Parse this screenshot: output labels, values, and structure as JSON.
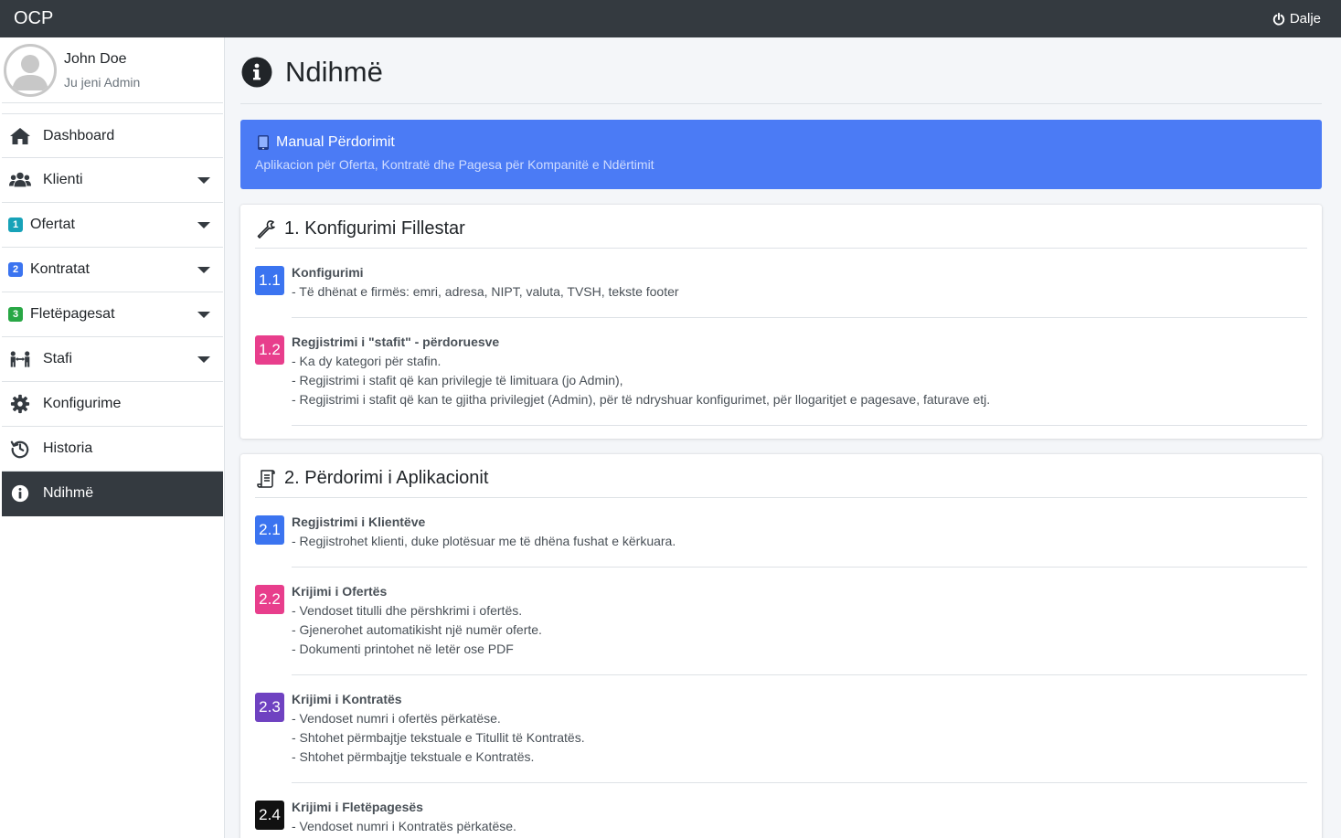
{
  "app": {
    "brand": "OCP",
    "logout_label": "Dalje"
  },
  "user": {
    "name": "John Doe",
    "role": "Ju jeni Admin"
  },
  "sidebar": {
    "items": [
      {
        "label": "Dashboard",
        "icon": "home-icon"
      },
      {
        "label": "Klienti",
        "icon": "users-icon",
        "dropdown": true
      },
      {
        "label": "Ofertat",
        "badge": "1",
        "badge_color": "#17a2b8",
        "dropdown": true
      },
      {
        "label": "Kontratat",
        "badge": "2",
        "badge_color": "#3b74f0",
        "dropdown": true
      },
      {
        "label": "Fletëpagesat",
        "badge": "3",
        "badge_color": "#28a745",
        "dropdown": true
      },
      {
        "label": "Stafi",
        "icon": "people-arrows-icon",
        "dropdown": true
      },
      {
        "label": "Konfigurime",
        "icon": "gear-icon"
      },
      {
        "label": "Historia",
        "icon": "history-icon"
      },
      {
        "label": "Ndihmë",
        "icon": "info-icon",
        "active": true
      }
    ]
  },
  "page": {
    "title": "Ndihmë"
  },
  "callout": {
    "title": "Manual Përdorimit",
    "subtitle": "Aplikacion për Oferta, Kontratë dhe Pagesa për Kompanitë e Ndërtimit",
    "color": "#4b7bf5"
  },
  "sections": [
    {
      "title": "1. Konfigurimi Fillestar",
      "icon": "wrench-icon",
      "steps": [
        {
          "num": "1.1",
          "color": "#3b74f0",
          "title": "Konfigurimi",
          "lines": [
            "- Të dhënat e firmës: emri, adresa, NIPT, valuta, TVSH, tekste footer"
          ]
        },
        {
          "num": "1.2",
          "color": "#e83e8c",
          "title": "Regjistrimi i \"stafit\" - përdoruesve",
          "lines": [
            "- Ka dy kategori për stafin.",
            "- Regjistrimi i stafit që kan privilegje të limituara (jo Admin),",
            "- Regjistrimi i stafit që kan te gjitha privilegjet (Admin), për të ndryshuar konfigurimet, për llogaritjet e pagesave, faturave etj."
          ]
        }
      ]
    },
    {
      "title": "2. Përdorimi i Aplikacionit",
      "icon": "scroll-icon",
      "steps": [
        {
          "num": "2.1",
          "color": "#3b74f0",
          "title": "Regjistrimi i Klientëve",
          "lines": [
            "- Regjistrohet klienti, duke plotësuar me të dhëna fushat e kërkuara."
          ]
        },
        {
          "num": "2.2",
          "color": "#e83e8c",
          "title": "Krijimi i Ofertës",
          "lines": [
            "- Vendoset titulli dhe përshkrimi i ofertës.",
            "- Gjenerohet automatikisht një numër oferte.",
            "- Dokumenti printohet në letër ose PDF"
          ]
        },
        {
          "num": "2.3",
          "color": "#6f42c1",
          "title": "Krijimi i Kontratës",
          "lines": [
            "- Vendoset numri i ofertës përkatëse.",
            "- Shtohet përmbajtje tekstuale e Titullit të Kontratës.",
            "- Shtohet përmbajtje tekstuale e Kontratës."
          ]
        },
        {
          "num": "2.4",
          "color": "#111111",
          "title": "Krijimi i Fletëpagesës",
          "lines": [
            "- Vendoset numri i Kontratës përkatëse."
          ]
        }
      ]
    }
  ]
}
